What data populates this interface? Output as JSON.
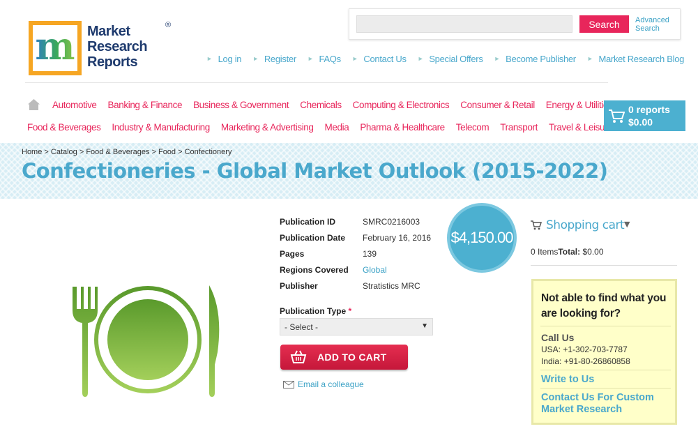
{
  "logo": {
    "letter": "m",
    "line1": "Market",
    "line2": "Research",
    "line3": "Reports",
    "reg": "®"
  },
  "search": {
    "placeholder": "",
    "button_label": "Search",
    "advanced_line1": "Advanced",
    "advanced_line2": "Search"
  },
  "top_links": [
    "Log in",
    "Register",
    "FAQs",
    "Contact Us",
    "Special Offers",
    "Become Publisher",
    "Market Research Blog"
  ],
  "categories_row1": [
    "Automotive",
    "Banking & Finance",
    "Business & Government",
    "Chemicals",
    "Computing & Electronics",
    "Consumer & Retail",
    "Energy & Utilities"
  ],
  "categories_row2": [
    "Food & Beverages",
    "Industry & Manufacturing",
    "Marketing & Advertising",
    "Media",
    "Pharma & Healthcare",
    "Telecom",
    "Transport",
    "Travel & Leisure"
  ],
  "cart": {
    "reports": "0 reports",
    "amount": "$0.00"
  },
  "breadcrumb": "Home > Catalog > Food & Beverages > Food > Confectionery",
  "title": "Confectioneries - Global Market Outlook (2015-2022)",
  "details": [
    {
      "key": "Publication ID",
      "value": "SMRC0216003",
      "link": false
    },
    {
      "key": "Publication Date",
      "value": "February 16, 2016",
      "link": false
    },
    {
      "key": "Pages",
      "value": "139",
      "link": false
    },
    {
      "key": "Regions Covered",
      "value": "Global",
      "link": true
    },
    {
      "key": "Publisher",
      "value": "Stratistics MRC",
      "link": false
    }
  ],
  "price": "$4,150.00",
  "publication_type": {
    "label": "Publication Type",
    "required_mark": "*",
    "selected": "- Select -"
  },
  "add_to_cart_label": "ADD TO CART",
  "email_label": "Email a colleague",
  "shopping_cart": {
    "title": "Shopping cart",
    "items": "0 Items",
    "total_label": "Total:",
    "total_value": "$0.00"
  },
  "help": {
    "question": "Not able to find what you are looking for?",
    "call_us": "Call Us",
    "usa": "USA: +1-302-703-7787",
    "india": "India: +91-80-26860858",
    "write_to_us": "Write to Us",
    "custom": "Contact Us For Custom Market Research"
  },
  "colors": {
    "accent_blue": "#4aa8cc",
    "accent_pink": "#e8265b",
    "cart_blue": "#4cb0d0",
    "help_bg": "#ffffc9"
  },
  "icons": [
    "home-icon",
    "cart-icon",
    "basket-icon",
    "envelope-icon",
    "dropdown-caret-icon",
    "fork-plate-knife-icon"
  ]
}
